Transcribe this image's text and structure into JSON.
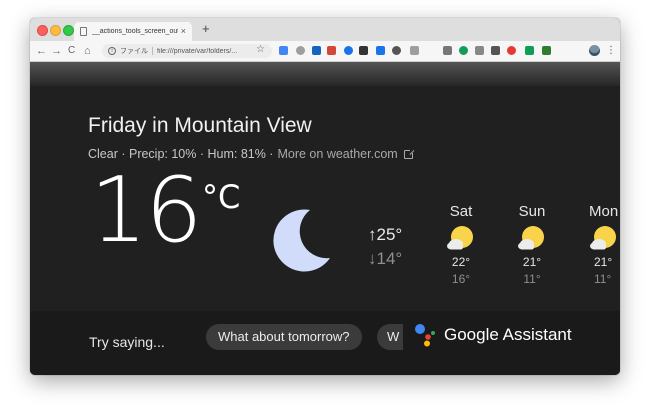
{
  "browser": {
    "tab_title": "__actions_tools_screen_out_da",
    "tab_close": "×",
    "new_tab": "+",
    "back": "←",
    "forward": "→",
    "reload": "C",
    "home": "⌂",
    "info": "i",
    "url_scheme": "ファイル",
    "url": "file:///private/var/folders/...",
    "star": "☆",
    "menu": "⋮",
    "extension_icons": [
      "calendar-icon",
      "bell-icon",
      "printer-icon",
      "gmail-icon",
      "record-icon",
      "info-icon",
      "calendar-icon",
      "tablet-icon",
      "translate-icon",
      "reader-icon",
      "hangouts-icon",
      "history-icon",
      "camera-icon",
      "adblock-icon",
      "arrow-icon",
      "shield-icon"
    ]
  },
  "weather": {
    "headline": "Friday in Mountain View",
    "summary": "Clear · Precip: 10% · Hum: 81% ·",
    "more_link": "More on weather.com",
    "temperature": "16",
    "unit": "°C",
    "condition_icon": "moon-icon",
    "high": "↑25°",
    "low": "↓14°",
    "forecast": [
      {
        "day": "Sat",
        "icon": "partly-cloudy-icon",
        "high": "22°",
        "low": "16°"
      },
      {
        "day": "Sun",
        "icon": "partly-cloudy-icon",
        "high": "21°",
        "low": "11°"
      },
      {
        "day": "Mon",
        "icon": "partly-cloudy-icon",
        "high": "21°",
        "low": "11°"
      }
    ]
  },
  "suggestions": {
    "label": "Try saying...",
    "chips": [
      "What about tomorrow?",
      "W"
    ]
  },
  "assistant": {
    "name": "Google Assistant"
  },
  "colors": {
    "background": "#202020",
    "chip": "#3b3b3b",
    "sun": "#f9d44b",
    "moon": "#d1dcfb"
  }
}
